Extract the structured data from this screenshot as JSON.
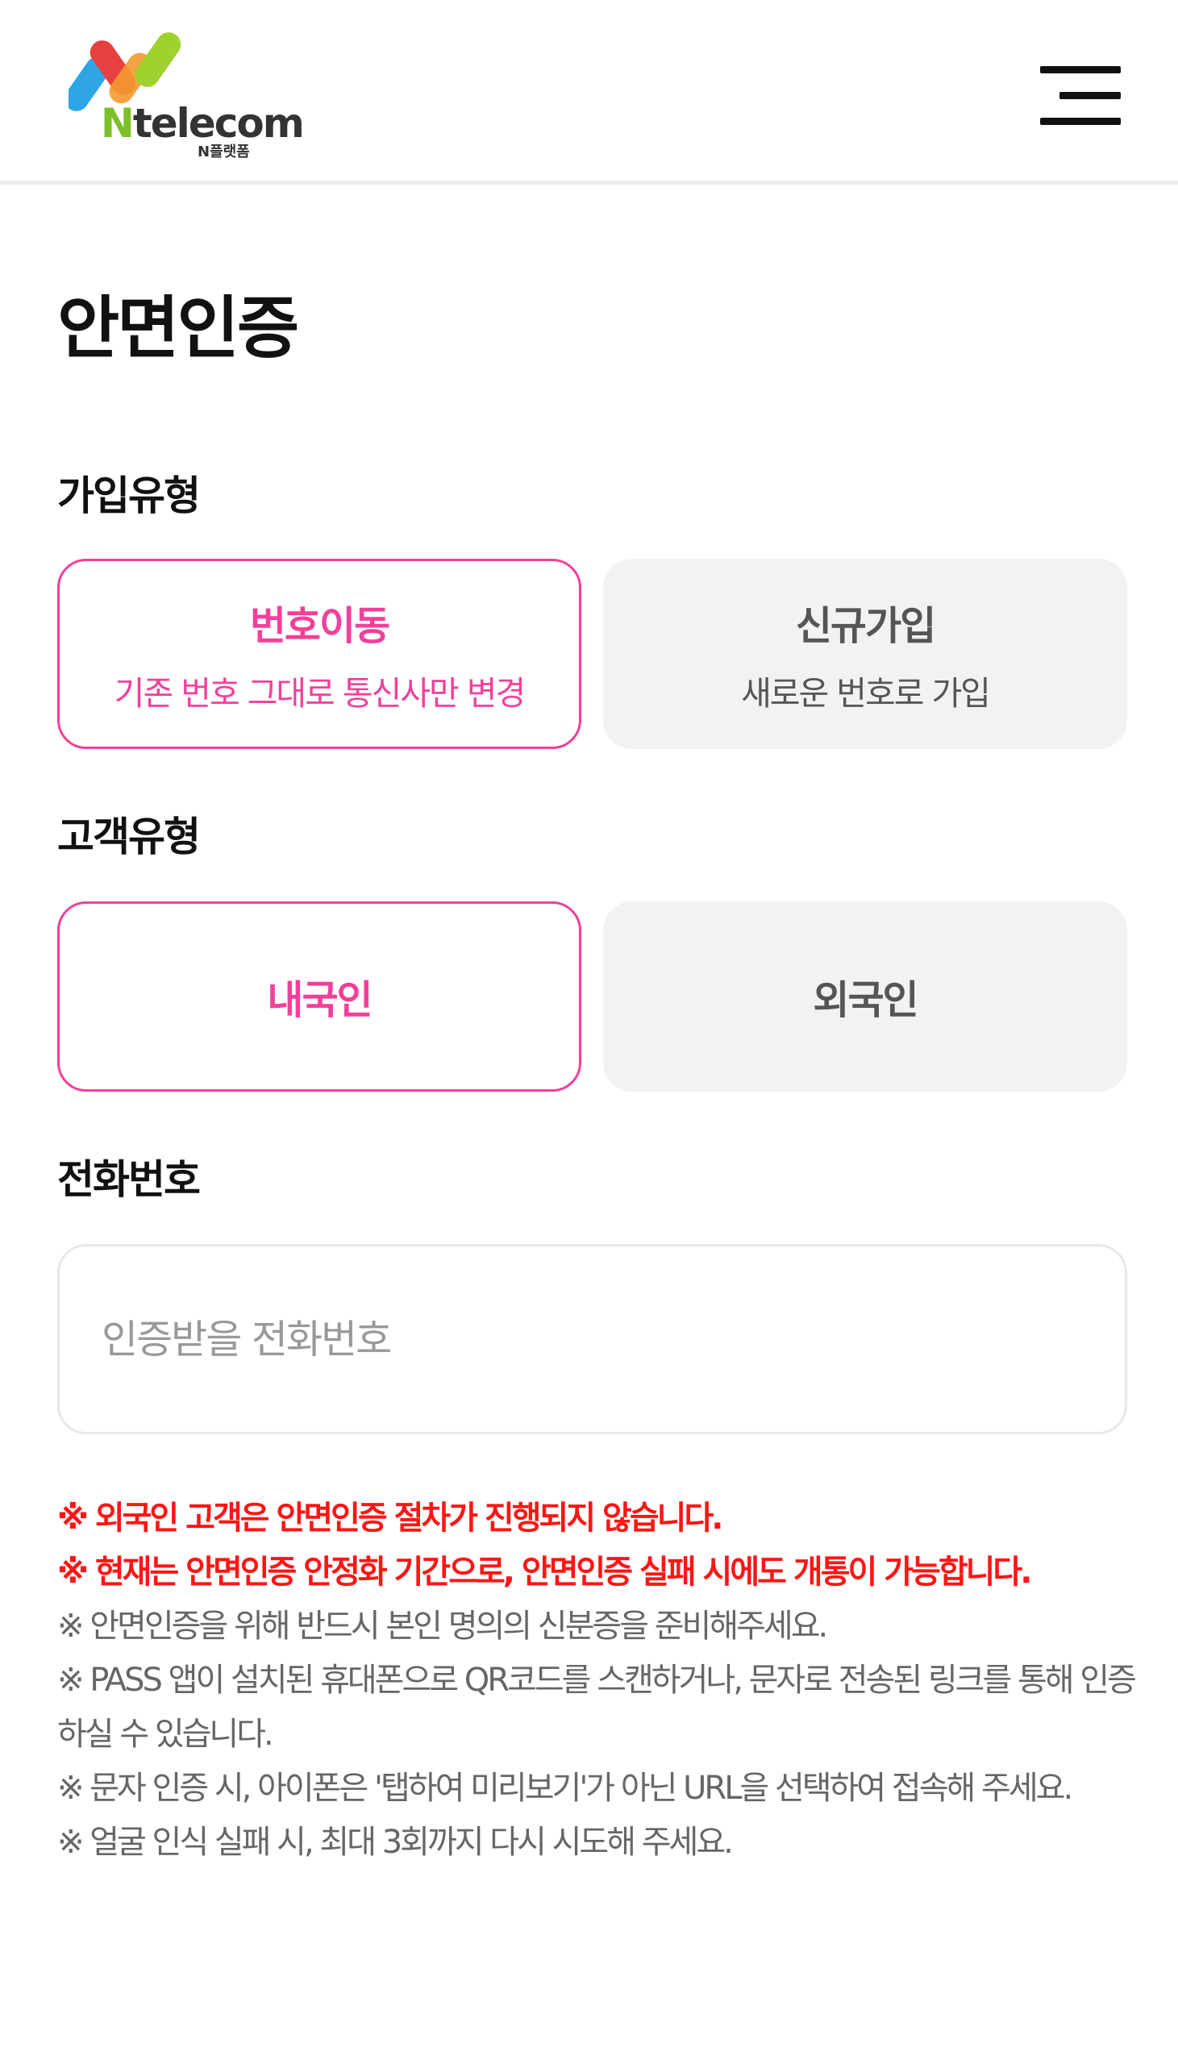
{
  "header": {
    "logo_brand_n": "N",
    "logo_brand_rest": "telecom",
    "logo_sub": "N플랫폼",
    "menu_icon": "hamburger-menu-icon"
  },
  "page": {
    "title": "안면인증"
  },
  "join_type": {
    "label": "가입유형",
    "options": [
      {
        "main": "번호이동",
        "sub": "기존 번호 그대로 통신사만 변경",
        "selected": true
      },
      {
        "main": "신규가입",
        "sub": "새로운 번호로 가입",
        "selected": false
      }
    ]
  },
  "customer_type": {
    "label": "고객유형",
    "options": [
      {
        "main": "내국인",
        "selected": true
      },
      {
        "main": "외국인",
        "selected": false
      }
    ]
  },
  "phone": {
    "label": "전화번호",
    "placeholder": "인증받을 전화번호",
    "value": ""
  },
  "notices": [
    {
      "text": "※ 외국인 고객은 안면인증 절차가 진행되지 않습니다.",
      "style": "red"
    },
    {
      "text": "※ 현재는 안면인증 안정화 기간으로, 안면인증 실패 시에도 개통이 가능합니다.",
      "style": "red"
    },
    {
      "text": "※ 안면인증을 위해 반드시 본인 명의의 신분증을 준비해주세요.",
      "style": "gray"
    },
    {
      "text": "※ PASS 앱이 설치된 휴대폰으로 QR코드를 스캔하거나, 문자로 전송된 링크를 통해 인증하실 수 있습니다.",
      "style": "gray"
    },
    {
      "text": "※ 문자 인증 시, 아이폰은 '탭하여 미리보기'가 아닌 URL을 선택하여 접속해 주세요.",
      "style": "gray"
    },
    {
      "text": "※ 얼굴 인식 실패 시, 최대 3회까지 다시 시도해 주세요.",
      "style": "gray"
    }
  ],
  "colors": {
    "accent": "#f2409a",
    "notice_red": "#ff1515",
    "logo_green": "#7cbf2a",
    "logo_blue": "#2ea6e6",
    "logo_red": "#e83f3f",
    "logo_orange": "#f29a2e",
    "logo_lime": "#9fd12f"
  }
}
